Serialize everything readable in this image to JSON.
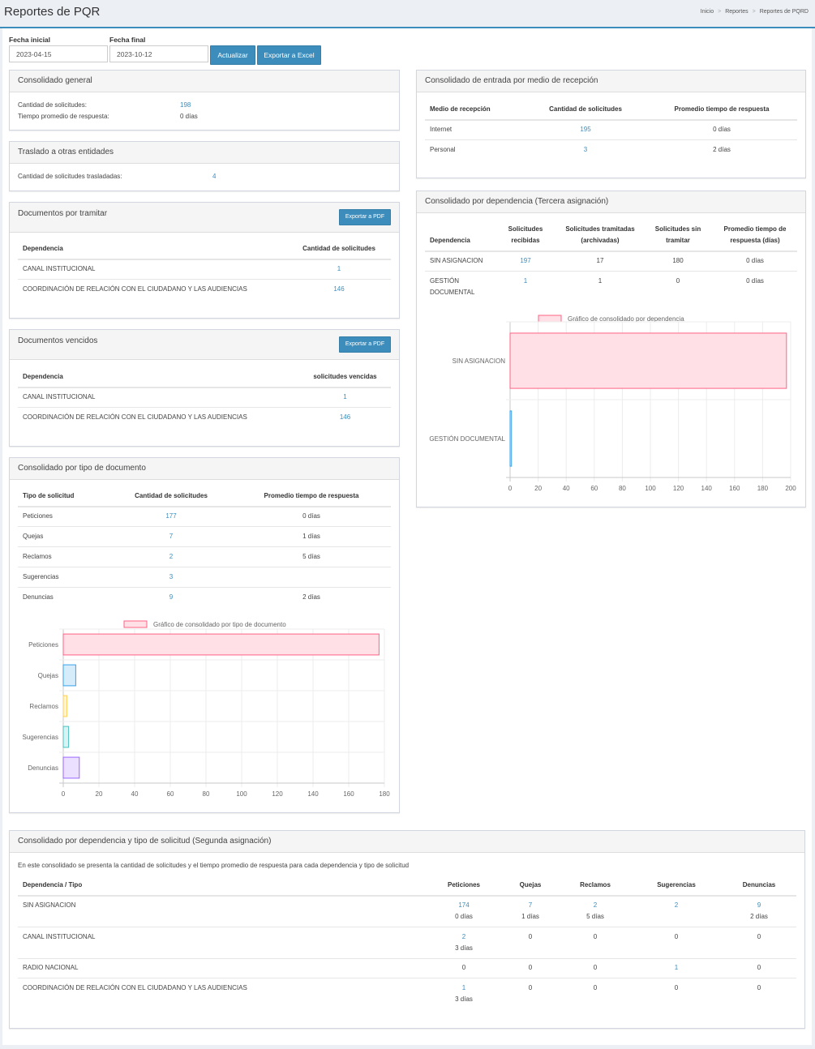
{
  "header": {
    "title": "Reportes de PQR",
    "breadcrumb": [
      "Inicio",
      "Reportes",
      "Reportes de PQRD"
    ]
  },
  "filters": {
    "start_label": "Fecha inicial",
    "start_value": "2023-04-15",
    "end_label": "Fecha final",
    "end_value": "2023-10-12",
    "update_button": "Actualizar",
    "export_button": "Exportar a Excel"
  },
  "general": {
    "title": "Consolidado general",
    "count_label": "Cantidad de solicitudes:",
    "count_value": "198",
    "time_label": "Tiempo promedio de respuesta:",
    "time_value": "0 días"
  },
  "transfer": {
    "title": "Traslado a otras entidades",
    "label": "Cantidad de solicitudes trasladadas:",
    "value": "4"
  },
  "pending": {
    "title": "Documentos por tramitar",
    "export_button": "Exportar a PDF",
    "headers": [
      "Dependencia",
      "Cantidad de solicitudes"
    ],
    "rows": [
      {
        "dep": "CANAL INSTITUCIONAL",
        "count": "1"
      },
      {
        "dep": "COORDINACIÓN DE RELACIÓN CON EL CIUDADANO Y LAS AUDIENCIAS",
        "count": "146"
      }
    ]
  },
  "expired": {
    "title": "Documentos vencidos",
    "export_button": "Exportar a PDF",
    "headers": [
      "Dependencia",
      "solicitudes vencidas"
    ],
    "rows": [
      {
        "dep": "CANAL INSTITUCIONAL",
        "count": "1"
      },
      {
        "dep": "COORDINACIÓN DE RELACIÓN CON EL CIUDADANO Y LAS AUDIENCIAS",
        "count": "146"
      }
    ]
  },
  "by_type": {
    "title": "Consolidado por tipo de documento",
    "headers": [
      "Tipo de solicitud",
      "Cantidad de solicitudes",
      "Promedio tiempo de respuesta"
    ],
    "rows": [
      {
        "type": "Peticiones",
        "count": "177",
        "avg": "0 días"
      },
      {
        "type": "Quejas",
        "count": "7",
        "avg": "1 días"
      },
      {
        "type": "Reclamos",
        "count": "2",
        "avg": "5 días"
      },
      {
        "type": "Sugerencias",
        "count": "3",
        "avg": ""
      },
      {
        "type": "Denuncias",
        "count": "9",
        "avg": "2 días"
      }
    ]
  },
  "by_medium": {
    "title": "Consolidado de entrada por medio de recepción",
    "headers": [
      "Medio de recepción",
      "Cantidad de solicitudes",
      "Promedio tiempo de respuesta"
    ],
    "rows": [
      {
        "medium": "Internet",
        "count": "195",
        "avg": "0 días"
      },
      {
        "medium": "Personal",
        "count": "3",
        "avg": "2 días"
      }
    ]
  },
  "by_dependency": {
    "title": "Consolidado por dependencia (Tercera asignación)",
    "headers": {
      "dep": "Dependencia",
      "received": [
        "Solicitudes",
        "recibidas"
      ],
      "archived": [
        "Solicitudes tramitadas",
        "(archivadas)"
      ],
      "pending": [
        "Solicitudes sin",
        "tramitar"
      ],
      "avg": [
        "Promedio tiempo de",
        "respuesta (días)"
      ]
    },
    "rows": [
      {
        "dep": [
          "SIN ASIGNACION"
        ],
        "received": "197",
        "archived": "17",
        "pending": "180",
        "avg": "0 días"
      },
      {
        "dep": [
          "GESTIÓN",
          "DOCUMENTAL"
        ],
        "received": "1",
        "archived": "1",
        "pending": "0",
        "avg": "0 días"
      }
    ]
  },
  "matrix": {
    "title": "Consolidado por dependencia y tipo de solicitud (Segunda asignación)",
    "description": "En este consolidado se presenta la cantidad de solicitudes y el tiempo promedio de respuesta para cada dependencia y tipo de solicitud",
    "headers": [
      "Dependencia / Tipo",
      "Peticiones",
      "Quejas",
      "Reclamos",
      "Sugerencias",
      "Denuncias"
    ],
    "rows": [
      {
        "dep": "SIN ASIGNACION",
        "cells": [
          {
            "v": "174",
            "d": "0 días",
            "link": true
          },
          {
            "v": "7",
            "d": "1 días",
            "link": true
          },
          {
            "v": "2",
            "d": "5 días",
            "link": true
          },
          {
            "v": "2",
            "d": "",
            "link": true
          },
          {
            "v": "9",
            "d": "2 días",
            "link": true
          }
        ]
      },
      {
        "dep": "CANAL INSTITUCIONAL",
        "cells": [
          {
            "v": "2",
            "d": "3 días",
            "link": true
          },
          {
            "v": "0",
            "d": "",
            "link": false
          },
          {
            "v": "0",
            "d": "",
            "link": false
          },
          {
            "v": "0",
            "d": "",
            "link": false
          },
          {
            "v": "0",
            "d": "",
            "link": false
          }
        ]
      },
      {
        "dep": "RADIO NACIONAL",
        "cells": [
          {
            "v": "0",
            "d": "",
            "link": false
          },
          {
            "v": "0",
            "d": "",
            "link": false
          },
          {
            "v": "0",
            "d": "",
            "link": false
          },
          {
            "v": "1",
            "d": "",
            "link": true
          },
          {
            "v": "0",
            "d": "",
            "link": false
          }
        ]
      },
      {
        "dep": "COORDINACIÓN DE RELACIÓN CON EL CIUDADANO Y LAS AUDIENCIAS",
        "cells": [
          {
            "v": "1",
            "d": "3 días",
            "link": true
          },
          {
            "v": "0",
            "d": "",
            "link": false
          },
          {
            "v": "0",
            "d": "",
            "link": false
          },
          {
            "v": "0",
            "d": "",
            "link": false
          },
          {
            "v": "0",
            "d": "",
            "link": false
          }
        ]
      }
    ]
  },
  "chart_data": [
    {
      "type": "bar",
      "orientation": "horizontal",
      "legend": "Gráfico de consolidado por tipo de documento",
      "categories": [
        "Peticiones",
        "Quejas",
        "Reclamos",
        "Sugerencias",
        "Denuncias"
      ],
      "values": [
        177,
        7,
        2,
        3,
        9
      ],
      "xlim": [
        0,
        180
      ],
      "ticks": [
        0,
        20,
        40,
        60,
        80,
        100,
        120,
        140,
        160,
        180
      ],
      "colors": [
        {
          "fill": "#ffe0e6",
          "stroke": "#ff6384"
        },
        {
          "fill": "#d7ecfb",
          "stroke": "#36a2eb"
        },
        {
          "fill": "#fff5dd",
          "stroke": "#ffcd56"
        },
        {
          "fill": "#dbf2f2",
          "stroke": "#4bc0c0"
        },
        {
          "fill": "#ebe0ff",
          "stroke": "#9966ff"
        }
      ]
    },
    {
      "type": "bar",
      "orientation": "horizontal",
      "legend": "Gráfico de consolidado por dependencia",
      "categories": [
        "SIN ASIGNACION",
        "GESTIÓN DOCUMENTAL"
      ],
      "values": [
        197,
        1
      ],
      "xlim": [
        0,
        200
      ],
      "ticks": [
        0,
        20,
        40,
        60,
        80,
        100,
        120,
        140,
        160,
        180,
        200
      ],
      "colors": [
        {
          "fill": "#ffe0e6",
          "stroke": "#ff6384"
        },
        {
          "fill": "#d7ecfb",
          "stroke": "#36a2eb"
        }
      ]
    }
  ]
}
